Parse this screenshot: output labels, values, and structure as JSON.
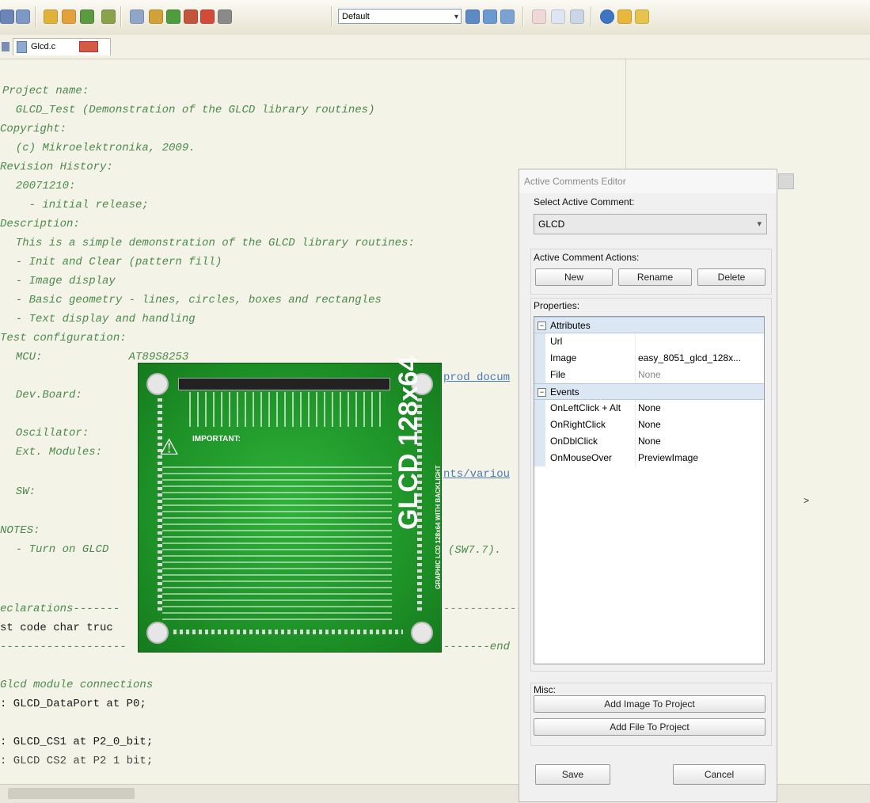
{
  "toolbar": {
    "scheme_select_value": "Default"
  },
  "tabs": [
    {
      "label": "Glcd.c"
    }
  ],
  "editor": {
    "lines": [
      {
        "text": "Project name:",
        "kind": "comment"
      },
      {
        "text": "  GLCD_Test (Demonstration of the GLCD library routines)",
        "kind": "comment"
      },
      {
        "text": "Copyright:",
        "kind": "comment"
      },
      {
        "text": "  (c) Mikroelektronika, 2009.",
        "kind": "comment"
      },
      {
        "text": "Revision History:",
        "kind": "comment"
      },
      {
        "text": "  20071210:",
        "kind": "comment"
      },
      {
        "text": "    - initial release;",
        "kind": "comment"
      },
      {
        "text": "Description:",
        "kind": "comment"
      },
      {
        "text": "  This is a simple demonstration of the GLCD library routines:",
        "kind": "comment"
      },
      {
        "text": "  - Init and Clear (pattern fill)",
        "kind": "comment"
      },
      {
        "text": "  - Image display",
        "kind": "comment"
      },
      {
        "text": "  - Basic geometry - lines, circles, boxes and rectangles",
        "kind": "comment"
      },
      {
        "text": "  - Text display and handling",
        "kind": "comment"
      },
      {
        "text": "Test configuration:",
        "kind": "comment"
      },
      {
        "text": "  MCU:             AT89S8253",
        "kind": "comment"
      },
      {
        "text": "prod_docum",
        "kind": "link"
      },
      {
        "text": "  Dev.Board:",
        "kind": "comment"
      },
      {
        "text": "  Oscillator:",
        "kind": "comment"
      },
      {
        "text": "  Ext. Modules:",
        "kind": "comment"
      },
      {
        "text": "nts/variou",
        "kind": "link"
      },
      {
        "text": "  SW:",
        "kind": "comment"
      },
      {
        "text": "NOTES:",
        "kind": "comment"
      },
      {
        "text": "  - Turn on GLCD",
        "kind": "comment"
      },
      {
        "text": "(SW7.7).",
        "kind": "comment"
      },
      {
        "text": "eclarations-------",
        "kind": "comment"
      },
      {
        "text": "------------------------------------",
        "kind": "comment"
      },
      {
        "text": "st code char truc",
        "kind": "code"
      },
      {
        "text": "-------------------",
        "kind": "comment"
      },
      {
        "text": "-------end",
        "kind": "comment"
      },
      {
        "text": "Glcd module connections",
        "kind": "comment"
      },
      {
        "text": ": GLCD_DataPort at P0;",
        "kind": "code"
      },
      {
        "text": ": GLCD_CS1 at P2_0_bit;",
        "kind": "code"
      },
      {
        "text": ": GLCD CS2 at P2 1 bit;",
        "kind": "code"
      }
    ]
  },
  "right_pane": {
    "expand_arrow": ">"
  },
  "board_image": {
    "label": "GLCD 128x64",
    "side_label": "GRAPHIC LCD 128x64 WITH BACKLIGHT",
    "warning_title": "IMPORTANT:"
  },
  "dialog": {
    "title": "Active Comments Editor",
    "select_label": "Select Active Comment:",
    "select_value": "GLCD",
    "actions_label": "Active Comment Actions:",
    "buttons": {
      "new": "New",
      "rename": "Rename",
      "delete": "Delete"
    },
    "properties_label": "Properties:",
    "properties": {
      "attributes_header": "Attributes",
      "attributes": [
        {
          "key": "Url",
          "value": ""
        },
        {
          "key": "Image",
          "value": "easy_8051_glcd_128x..."
        },
        {
          "key": "File",
          "value": "None"
        }
      ],
      "events_header": "Events",
      "events": [
        {
          "key": "OnLeftClick + Alt",
          "value": "None"
        },
        {
          "key": "OnRightClick",
          "value": "None"
        },
        {
          "key": "OnDblClick",
          "value": "None"
        },
        {
          "key": "OnMouseOver",
          "value": "PreviewImage"
        }
      ]
    },
    "misc_label": "Misc:",
    "add_image_button": "Add Image To Project",
    "add_file_button": "Add File To Project",
    "save_button": "Save",
    "cancel_button": "Cancel"
  },
  "colors": {
    "comment_text": "#4b8a4b",
    "board_green": "#1c8e25",
    "grid_category": "#dbe7f3"
  }
}
